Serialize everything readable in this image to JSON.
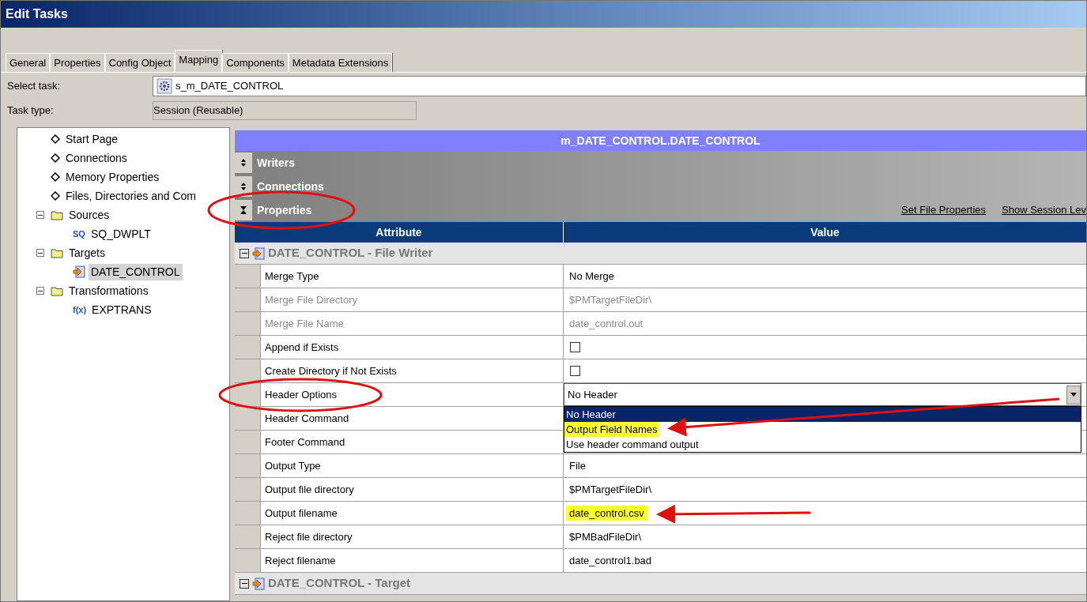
{
  "window": {
    "title": "Edit Tasks"
  },
  "tabs": [
    {
      "label": "General",
      "selected": false
    },
    {
      "label": "Properties",
      "selected": false
    },
    {
      "label": "Config Object",
      "selected": false
    },
    {
      "label": "Mapping",
      "selected": true
    },
    {
      "label": "Components",
      "selected": false
    },
    {
      "label": "Metadata Extensions",
      "selected": false
    }
  ],
  "select_task": {
    "label": "Select task:",
    "value": "s_m_DATE_CONTROL"
  },
  "task_type": {
    "label": "Task type:",
    "value": "Session (Reusable)"
  },
  "tree": [
    {
      "label": "Start Page",
      "kind": "page"
    },
    {
      "label": "Connections",
      "kind": "page"
    },
    {
      "label": "Memory Properties",
      "kind": "page"
    },
    {
      "label": "Files, Directories and Com",
      "kind": "page"
    },
    {
      "label": "Sources",
      "kind": "folder",
      "expanded": true,
      "children": [
        {
          "label": "SQ_DWPLT",
          "kind": "source",
          "badge": "SQ",
          "selected": false
        }
      ]
    },
    {
      "label": "Targets",
      "kind": "folder",
      "expanded": true,
      "children": [
        {
          "label": "DATE_CONTROL",
          "kind": "target",
          "selected": true
        }
      ]
    },
    {
      "label": "Transformations",
      "kind": "folder",
      "expanded": true,
      "children": [
        {
          "label": "EXPTRANS",
          "kind": "expression",
          "badge": "f(x)",
          "selected": false
        }
      ]
    }
  ],
  "panel": {
    "title": "m_DATE_CONTROL.DATE_CONTROL",
    "sections": [
      {
        "label": "Writers",
        "expanded": false
      },
      {
        "label": "Connections",
        "expanded": false
      },
      {
        "label": "Properties",
        "expanded": true
      }
    ],
    "links": [
      "Set File Properties",
      "Show Session Lev"
    ],
    "table": {
      "columns": [
        "Attribute",
        "Value"
      ],
      "groups": [
        {
          "label": "DATE_CONTROL - File Writer",
          "expanded": true,
          "rows": [
            {
              "attribute": "Merge Type",
              "kind": "text",
              "value": "No Merge",
              "disabled": false,
              "highlighted": false
            },
            {
              "attribute": "Merge File Directory",
              "kind": "text",
              "value": "$PMTargetFileDir\\",
              "disabled": true,
              "highlighted": false
            },
            {
              "attribute": "Merge File Name",
              "kind": "text",
              "value": "date_control.out",
              "disabled": true,
              "highlighted": false
            },
            {
              "attribute": "Append if Exists",
              "kind": "checkbox",
              "checked": false,
              "disabled": false
            },
            {
              "attribute": "Create Directory if Not Exists",
              "kind": "checkbox",
              "checked": false,
              "disabled": false
            },
            {
              "attribute": "Header Options",
              "kind": "dropdown",
              "value": "No Header",
              "disabled": false,
              "options": [
                {
                  "label": "No Header",
                  "selected": true,
                  "highlighted": false
                },
                {
                  "label": "Output Field Names",
                  "selected": false,
                  "highlighted": true
                },
                {
                  "label": "Use header command output",
                  "selected": false,
                  "highlighted": false
                }
              ]
            },
            {
              "attribute": "Header Command",
              "kind": "empty",
              "disabled": false
            },
            {
              "attribute": "Footer Command",
              "kind": "empty",
              "disabled": false
            },
            {
              "attribute": "Output Type",
              "kind": "text",
              "value": "File",
              "disabled": false,
              "highlighted": false
            },
            {
              "attribute": "Output file directory",
              "kind": "text",
              "value": "$PMTargetFileDir\\",
              "disabled": false,
              "highlighted": false
            },
            {
              "attribute": "Output filename",
              "kind": "text",
              "value": "date_control.csv",
              "disabled": false,
              "highlighted": true
            },
            {
              "attribute": "Reject file directory",
              "kind": "text",
              "value": "$PMBadFileDir\\",
              "disabled": false,
              "highlighted": false
            },
            {
              "attribute": "Reject filename",
              "kind": "text",
              "value": "date_control1.bad",
              "disabled": false,
              "highlighted": false
            }
          ]
        },
        {
          "label": "DATE_CONTROL - Target",
          "expanded": true
        }
      ]
    }
  }
}
